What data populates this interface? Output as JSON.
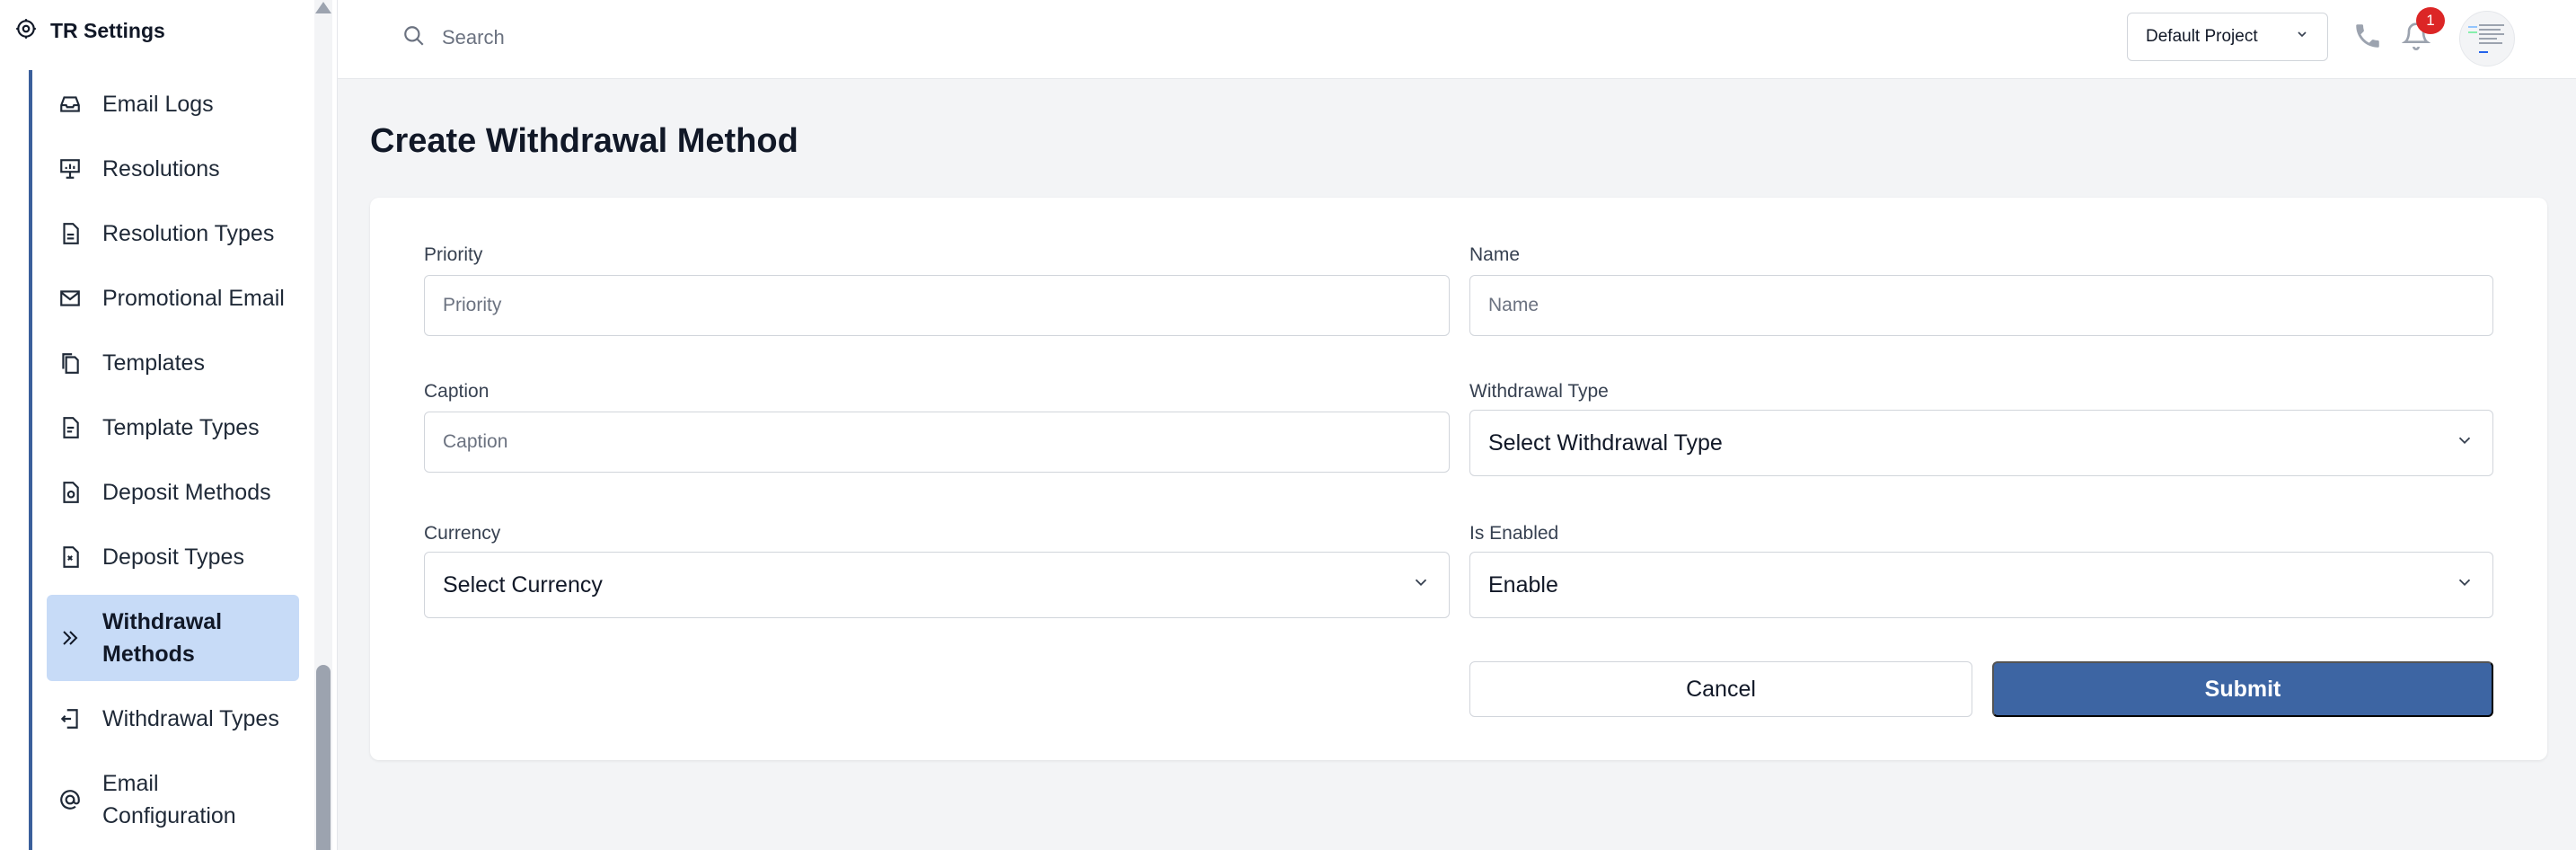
{
  "sidebar": {
    "title": "TR Settings",
    "items": [
      {
        "label": "Email Logs",
        "icon": "inbox-icon"
      },
      {
        "label": "Resolutions",
        "icon": "presentation-icon"
      },
      {
        "label": "Resolution Types",
        "icon": "document-icon"
      },
      {
        "label": "Promotional Email",
        "icon": "mail-icon"
      },
      {
        "label": "Templates",
        "icon": "copy-icon"
      },
      {
        "label": "Template Types",
        "icon": "document-text-icon"
      },
      {
        "label": "Deposit Methods",
        "icon": "document-refresh-icon"
      },
      {
        "label": "Deposit Types",
        "icon": "document-check-icon"
      },
      {
        "label": "Withdrawal Methods",
        "icon": "double-chevron-right-icon",
        "active": true
      },
      {
        "label": "Withdrawal Types",
        "icon": "exit-icon"
      },
      {
        "label": "Email Configuration",
        "icon": "at-sign-icon"
      }
    ]
  },
  "header": {
    "search_placeholder": "Search",
    "project": "Default Project",
    "notification_count": "1"
  },
  "main": {
    "title": "Create Withdrawal Method",
    "form": {
      "priority": {
        "label": "Priority",
        "placeholder": "Priority"
      },
      "name": {
        "label": "Name",
        "placeholder": "Name"
      },
      "caption": {
        "label": "Caption",
        "placeholder": "Caption"
      },
      "withdrawal_type": {
        "label": "Withdrawal Type",
        "value": "Select Withdrawal Type"
      },
      "currency": {
        "label": "Currency",
        "value": "Select Currency"
      },
      "is_enabled": {
        "label": "Is Enabled",
        "value": "Enable"
      }
    },
    "cancel_label": "Cancel",
    "submit_label": "Submit"
  },
  "colors": {
    "accent": "#3d65a3",
    "active_item_bg": "#c7dbf7",
    "badge": "#dc2626"
  }
}
